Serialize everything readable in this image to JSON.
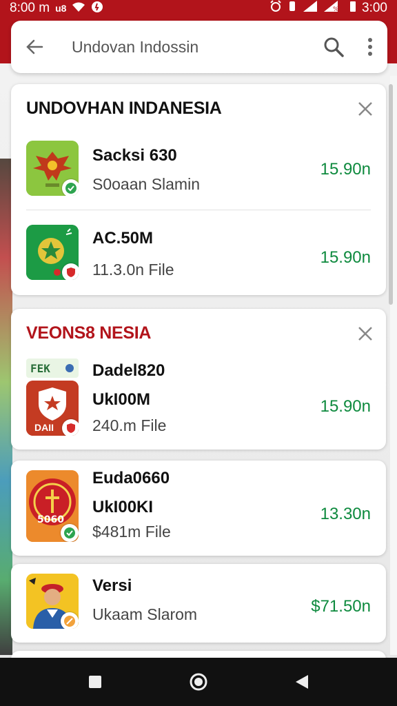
{
  "status_bar": {
    "time_left": "8:00 m",
    "extra_left": "u8",
    "time_right": "3:00"
  },
  "search": {
    "value": "Undovan Indossin",
    "back_icon": "arrow-left-icon",
    "search_icon": "search-icon",
    "menu_icon": "more-vert-icon"
  },
  "sections": [
    {
      "title": "UNDOVHAN INDANESIA",
      "title_color": "#111111",
      "items": [
        {
          "title": "Sacksi 630",
          "subtitle": "S0oaan Slamin",
          "price": "15.90n"
        },
        {
          "title": "AC.50M",
          "subtitle": "11.3.0n File",
          "price": "15.90n"
        }
      ]
    },
    {
      "title": "VEONS8 NESIA",
      "title_color": "#b2141b",
      "items": [
        {
          "banner": "FEK",
          "title": "Dadel820",
          "title2": "UkI00M",
          "subtitle": "240.m File",
          "price": "15.90n",
          "icon_text": "DAII"
        }
      ]
    }
  ],
  "standalone": [
    {
      "title": "Euda0660",
      "title2": "UkI00KI",
      "subtitle": "$481m File",
      "price": "13.30n"
    },
    {
      "title": "Versi",
      "subtitle": "Ukaam Slarom",
      "price": "$71.50n"
    }
  ],
  "colors": {
    "accent": "#b2141b",
    "price": "#0e8a3e"
  },
  "nav": {
    "icons": [
      "square-recent-icon",
      "circle-home-icon",
      "triangle-back-icon"
    ]
  }
}
